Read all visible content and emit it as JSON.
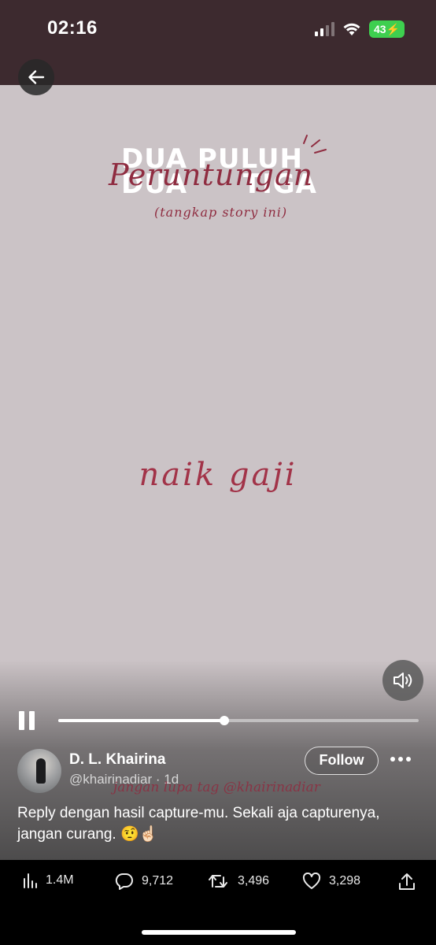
{
  "status_bar": {
    "time": "02:16",
    "battery": "43",
    "signal_bars_active": 2,
    "signal_bars_total": 4
  },
  "navigation": {
    "back_icon": "arrow-left-icon"
  },
  "video": {
    "background_text_line1": "DUA PULUH",
    "background_text_line2": "DUA TIGA",
    "title": "Peruntungan",
    "subtitle": "(tangkap story ini)",
    "result_text": "naik gaji",
    "watermark": "jangan lupa tag @khairinadiar",
    "progress_fraction": 0.46,
    "volume_icon": "speaker-icon",
    "pause_icon": "pause-icon",
    "colors": {
      "background": "#cbc3c6",
      "handwriting": "#8f2c40"
    }
  },
  "author": {
    "name": "D. L. Khairina",
    "handle_meta": "@khairinadiar · 1d",
    "follow_label": "Follow"
  },
  "tweet": {
    "text": "Reply dengan hasil capture-mu. Sekali aja capturenya, jangan curang. 🤨☝🏻"
  },
  "actions": {
    "views": "1.4M",
    "replies": "9,712",
    "retweets": "3,496",
    "likes": "3,298"
  }
}
